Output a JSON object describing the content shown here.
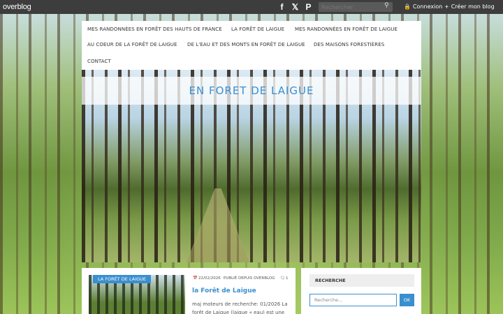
{
  "topbar": {
    "logo": "overblog",
    "social": [
      {
        "icon": "facebook-icon",
        "glyph": "f"
      },
      {
        "icon": "x-icon",
        "glyph": "𝕏"
      },
      {
        "icon": "pinterest-icon",
        "glyph": "P"
      }
    ],
    "search_placeholder": "Rechercher",
    "login_label": "Connexion",
    "create_label": "Créer mon blog"
  },
  "nav": {
    "items": [
      "MES RANDONNÉES EN FORÊT DES HAUTS DE FRANCE",
      "LA FORÊT DE LAIGUE",
      "MES RANDONNÉES EN FORÊT DE LAIGUE",
      "AU COEUR DE LA FORÊT DE LAIGUE",
      "DE L'EAU ET DES MONTS EN FORÊT DE LAIGUE",
      "DES MAISONS FORESTIÈRES",
      "CONTACT"
    ]
  },
  "site": {
    "title": "EN FORET DE LAIGUE"
  },
  "article": {
    "category": "LA FORÊT DE LAIGUE",
    "date": "22/02/2026",
    "author": "PUBLIÉ DEPUIS OVERBLOG",
    "comments": "1",
    "title": "la Forêt de Laigue",
    "excerpt": "maj moteurs de recherche: 01/2026 La forêt de Laigue (laigue « eau) est une"
  },
  "sidebar": {
    "widget_title": "RECHERCHE",
    "search_placeholder": "Recherche...",
    "search_button": "OK"
  },
  "colors": {
    "accent": "#3a8fcf",
    "topbar": "#3d3d3d"
  }
}
